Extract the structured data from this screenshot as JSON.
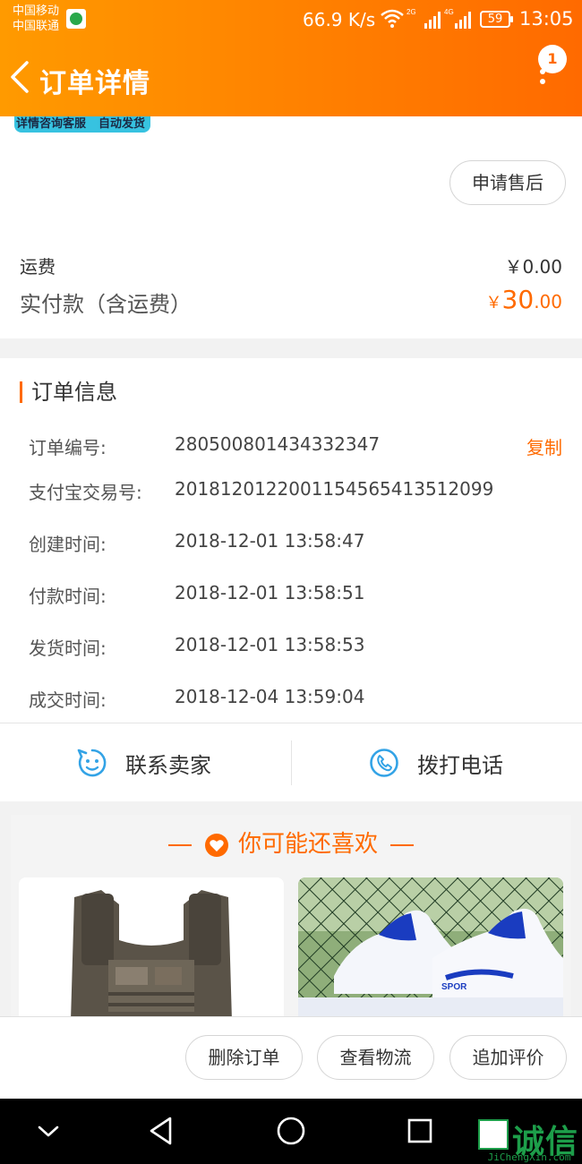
{
  "status_bar": {
    "carrier1": "中国移动",
    "carrier2": "中国联通",
    "net_speed": "66.9 K/s",
    "battery": "59",
    "time": "13:05"
  },
  "header": {
    "title": "订单详情",
    "badge": "1"
  },
  "promo": {
    "tag1": "详情咨询客服",
    "tag2": "自动发货"
  },
  "summary": {
    "aftersale_label": "申请售后",
    "shipping_label": "运费",
    "shipping_value": "￥0.00",
    "paid_label": "实付款（含运费）",
    "paid_currency": "￥",
    "paid_int": "30",
    "paid_dec": ".00"
  },
  "order_info": {
    "title": "订单信息",
    "copy_label": "复制",
    "rows": [
      {
        "label": "订单编号:",
        "value": "280500801434332347"
      },
      {
        "label": "支付宝交易号:",
        "value": "2018120122001154565413512099"
      },
      {
        "label": "创建时间:",
        "value": "2018-12-01 13:58:47"
      },
      {
        "label": "付款时间:",
        "value": "2018-12-01 13:58:51"
      },
      {
        "label": "发货时间:",
        "value": "2018-12-01 13:58:53"
      },
      {
        "label": "成交时间:",
        "value": "2018-12-04 13:59:04"
      }
    ]
  },
  "actions": {
    "contact_seller": "联系卖家",
    "call_phone": "拨打电话"
  },
  "recommend": {
    "title": "你可能还喜欢",
    "shoe_text": "SPOR"
  },
  "bottom_actions": {
    "delete": "删除订单",
    "logistics": "查看物流",
    "review": "追加评价"
  },
  "watermark": {
    "brand": "诚信",
    "domain": "JiChengXin.com"
  },
  "colors": {
    "accent": "#ff6a00",
    "header_start": "#ff9a00",
    "header_end": "#ff6a00"
  }
}
